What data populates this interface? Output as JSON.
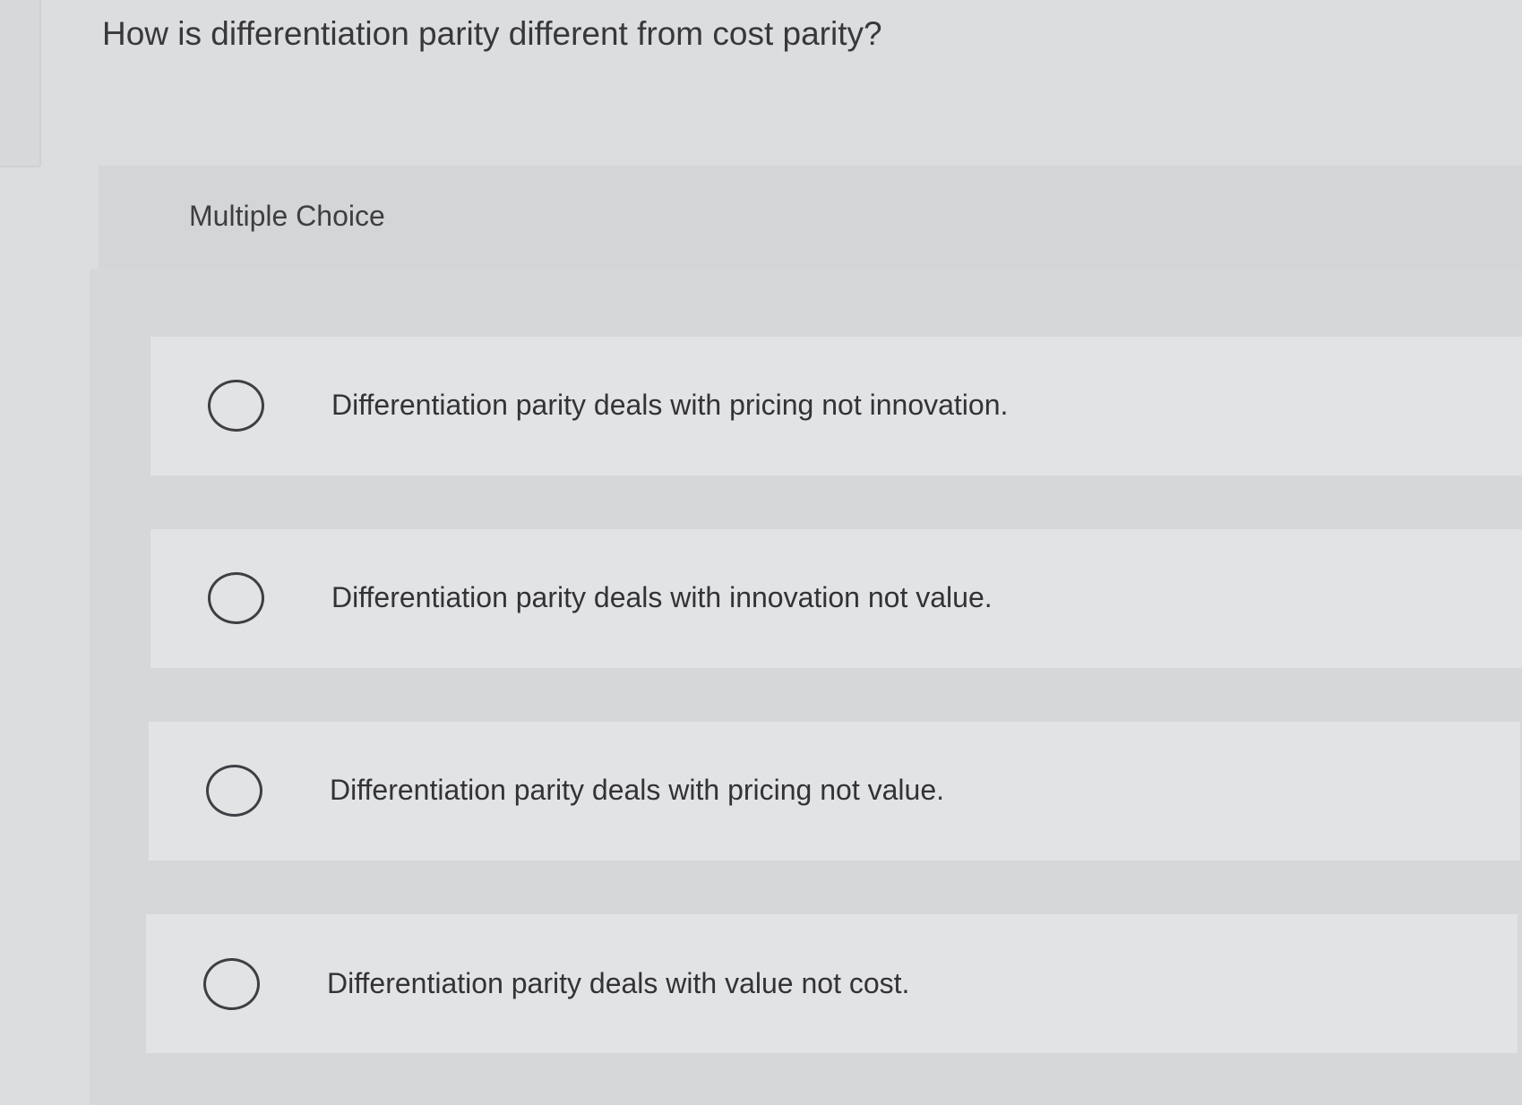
{
  "question": {
    "text": "How is differentiation parity different from cost parity?"
  },
  "multiple_choice": {
    "label": "Multiple Choice",
    "selected": null,
    "options": [
      {
        "label": "Differentiation parity deals with pricing not innovation."
      },
      {
        "label": "Differentiation parity deals with innovation not value."
      },
      {
        "label": "Differentiation parity deals with pricing not value."
      },
      {
        "label": "Differentiation parity deals with value not cost."
      }
    ]
  },
  "colors": {
    "background": "#dcdddf",
    "option_background": "#e2e3e5",
    "text": "#38383c",
    "radio_border": "#3e3e44"
  }
}
